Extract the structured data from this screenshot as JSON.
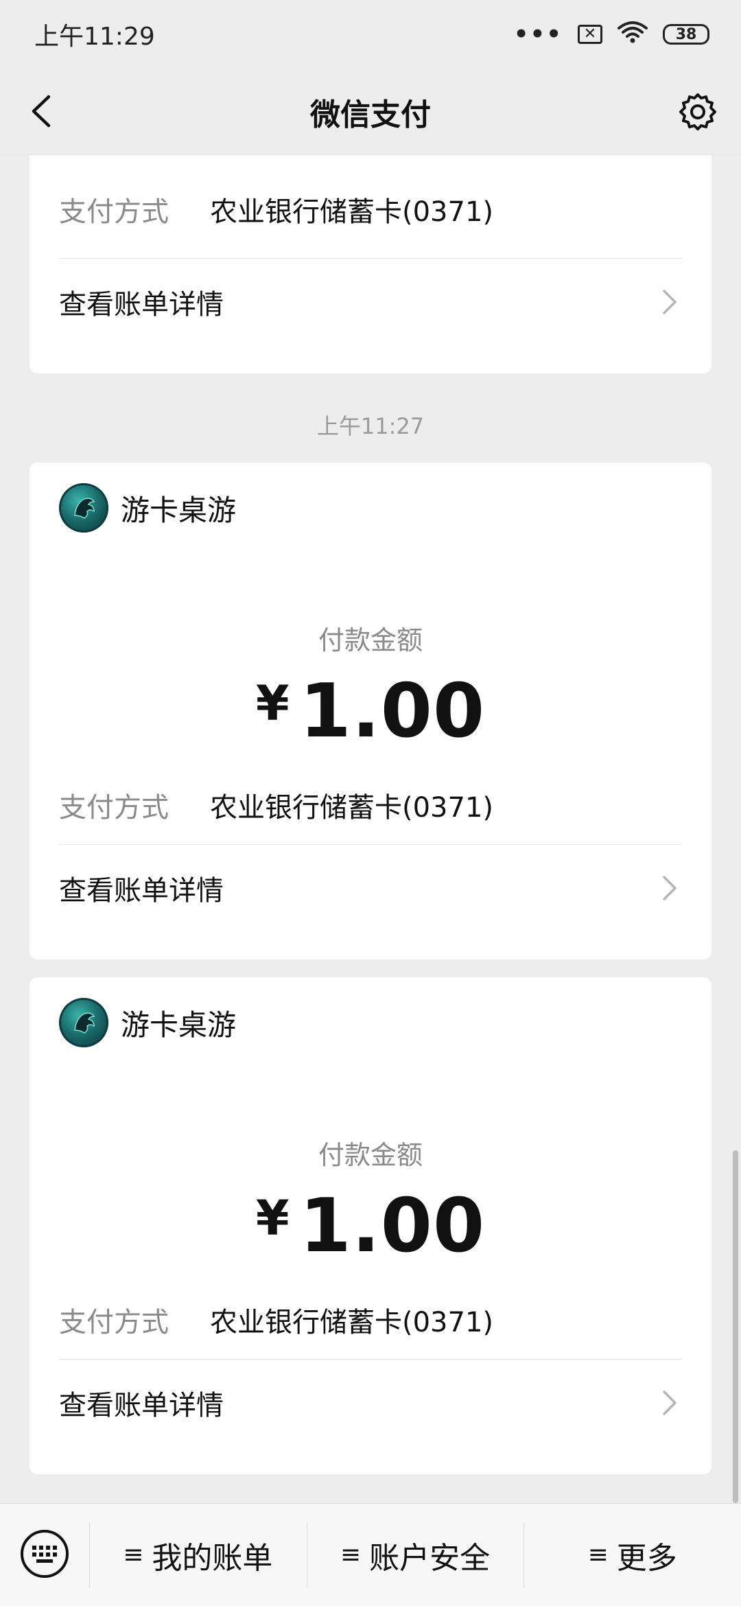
{
  "status_bar": {
    "time": "上午11:29",
    "dots": "•••",
    "sim_icon": "sim-blocked-icon",
    "wifi_icon": "wifi-icon",
    "battery": "38"
  },
  "nav": {
    "title": "微信支付",
    "back_icon": "back-arrow-icon",
    "settings_icon": "gear-icon"
  },
  "cards": {
    "top": {
      "payment_method_label": "支付方式",
      "payment_method_value": "农业银行储蓄卡(0371)",
      "detail_label": "查看账单详情"
    },
    "time_label": "上午11:27",
    "a": {
      "merchant": "游卡桌游",
      "amount_label": "付款金额",
      "currency": "¥",
      "amount": "1.00",
      "payment_method_label": "支付方式",
      "payment_method_value": "农业银行储蓄卡(0371)",
      "detail_label": "查看账单详情"
    },
    "b": {
      "merchant": "游卡桌游",
      "amount_label": "付款金额",
      "currency": "¥",
      "amount": "1.00",
      "payment_method_label": "支付方式",
      "payment_method_value": "农业银行储蓄卡(0371)",
      "detail_label": "查看账单详情"
    }
  },
  "bottom_menu": {
    "keyboard_icon": "keyboard-icon",
    "menu_icon": "≡",
    "items": [
      "我的账单",
      "账户安全",
      "更多"
    ]
  },
  "colors": {
    "background": "#ededed",
    "card": "#ffffff",
    "muted_text": "#8a8a8a",
    "primary_text": "#111111"
  }
}
